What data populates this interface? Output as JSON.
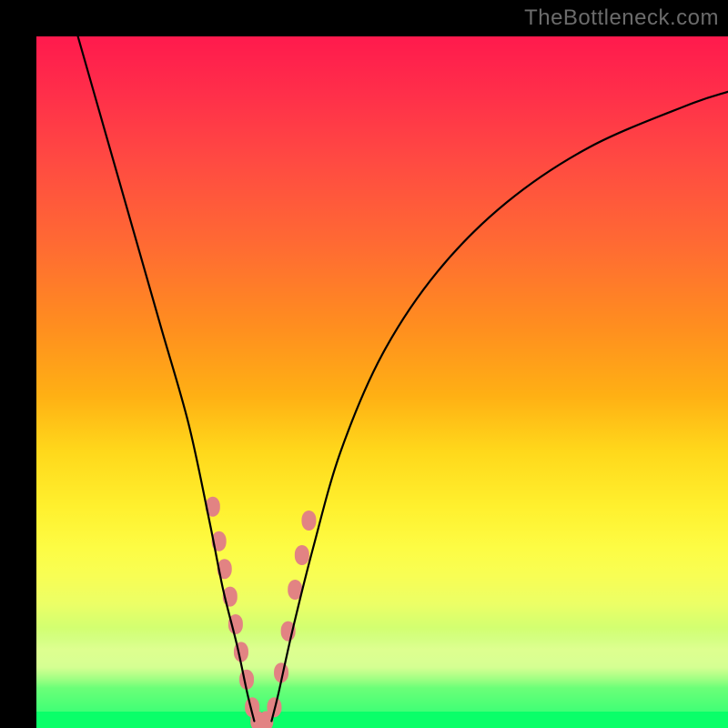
{
  "watermark": "TheBottleneck.com",
  "chart_data": {
    "type": "line",
    "title": "",
    "xlabel": "",
    "ylabel": "",
    "xlim": [
      0,
      100
    ],
    "ylim": [
      0,
      100
    ],
    "series": [
      {
        "name": "left-curve",
        "x": [
          6,
          10,
          14,
          18,
          22,
          25,
          27,
          29,
          30.5,
          31.5
        ],
        "y": [
          100,
          86,
          72,
          58,
          44,
          30,
          20,
          12,
          5,
          1
        ]
      },
      {
        "name": "right-curve",
        "x": [
          34,
          35,
          37,
          40,
          44,
          50,
          58,
          68,
          80,
          94,
          100
        ],
        "y": [
          1,
          5,
          14,
          26,
          40,
          54,
          66,
          76,
          84,
          90,
          92
        ]
      }
    ],
    "markers": {
      "name": "highlighted-points",
      "color": "#e28383",
      "points": [
        {
          "x": 25.5,
          "y": 32
        },
        {
          "x": 26.4,
          "y": 27
        },
        {
          "x": 27.2,
          "y": 23
        },
        {
          "x": 28.0,
          "y": 19
        },
        {
          "x": 28.8,
          "y": 15
        },
        {
          "x": 29.6,
          "y": 11
        },
        {
          "x": 30.4,
          "y": 7
        },
        {
          "x": 31.2,
          "y": 3
        },
        {
          "x": 32.0,
          "y": 1
        },
        {
          "x": 33.2,
          "y": 1
        },
        {
          "x": 34.4,
          "y": 3
        },
        {
          "x": 35.4,
          "y": 8
        },
        {
          "x": 36.4,
          "y": 14
        },
        {
          "x": 37.4,
          "y": 20
        },
        {
          "x": 38.4,
          "y": 25
        },
        {
          "x": 39.4,
          "y": 30
        }
      ]
    },
    "background": {
      "type": "vertical-gradient",
      "stops": [
        {
          "pos": 0,
          "color": "#ff1a4d"
        },
        {
          "pos": 50,
          "color": "#ffd81b"
        },
        {
          "pos": 100,
          "color": "#0aff69"
        }
      ]
    }
  }
}
